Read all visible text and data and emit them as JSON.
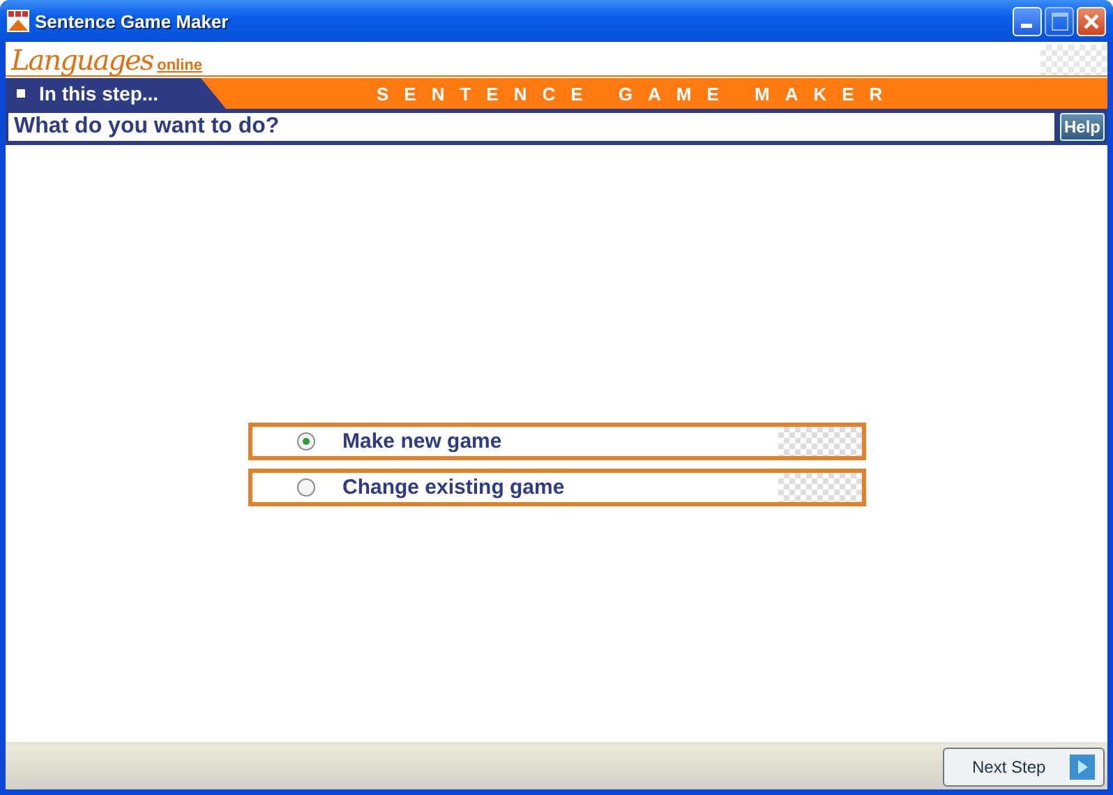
{
  "window": {
    "title": "Sentence Game Maker"
  },
  "logo": {
    "word": "Languages",
    "suffix": "online"
  },
  "banner": {
    "step_label": "In this step...",
    "title": "SENTENCE GAME MAKER"
  },
  "question": {
    "text": "What do you want to do?",
    "help": "Help"
  },
  "options": [
    {
      "label": "Make new game",
      "selected": true
    },
    {
      "label": "Change existing game",
      "selected": false
    }
  ],
  "footer": {
    "next": "Next Step"
  }
}
